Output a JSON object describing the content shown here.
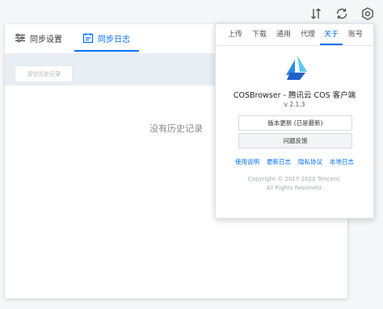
{
  "topbar": {
    "icons": [
      "sort-arrows-icon",
      "refresh-icon",
      "settings-icon"
    ]
  },
  "main": {
    "tabs": [
      {
        "label": "同步设置",
        "icon": "sliders-icon",
        "active": false
      },
      {
        "label": "同步日志",
        "icon": "calendar-icon",
        "active": true
      }
    ],
    "clear_label": "清空历史记录",
    "empty_text": "没有历史记录"
  },
  "popover": {
    "tabs": [
      {
        "label": "上传",
        "active": false
      },
      {
        "label": "下载",
        "active": false
      },
      {
        "label": "通用",
        "active": false
      },
      {
        "label": "代理",
        "active": false
      },
      {
        "label": "关于",
        "active": true
      },
      {
        "label": "账号",
        "active": false
      }
    ],
    "app_name": "COSBrowser - 腾讯云 COS 客户端",
    "version": "v 2.1.3",
    "update_button": "版本更新 (已是最新)",
    "feedback_button": "问题反馈",
    "links": [
      "使用说明",
      "更新日志",
      "隐私协议",
      "本地日志"
    ],
    "copyright_line1": "Copyright © 2017-2020 Tencent.",
    "copyright_line2": "All Rights Reserved."
  },
  "colors": {
    "accent": "#006eff",
    "strip": "#e8eef3",
    "logo_light": "#5ec8f2",
    "logo_dark": "#1f5fc8"
  }
}
